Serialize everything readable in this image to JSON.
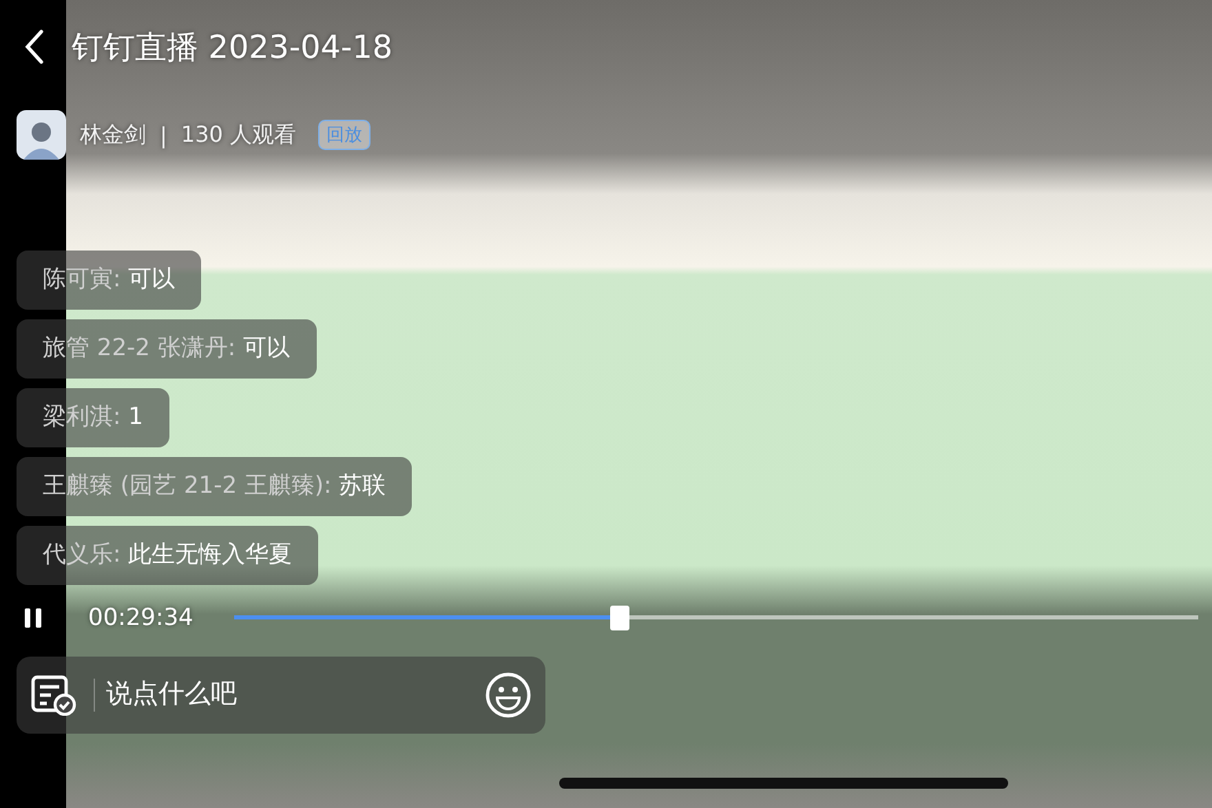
{
  "header": {
    "title": "钉钉直播 2023-04-18",
    "host": "林金剑",
    "separator": "|",
    "viewers": "130 人观看",
    "badge": "回放"
  },
  "comments": [
    {
      "name": "陈可寅: ",
      "text": "可以"
    },
    {
      "name": "旅管 22-2 张潇丹: ",
      "text": "可以"
    },
    {
      "name": "梁利淇: ",
      "text": "1"
    },
    {
      "name": "王麒臻 (园艺 21-2 王麒臻): ",
      "text": "苏联"
    },
    {
      "name": "代义乐: ",
      "text": "此生无悔入华夏"
    }
  ],
  "player": {
    "playing": true,
    "time": "00:29:34",
    "level": 0.4
  },
  "comment_box": {
    "placeholder": "说点什么吧"
  }
}
